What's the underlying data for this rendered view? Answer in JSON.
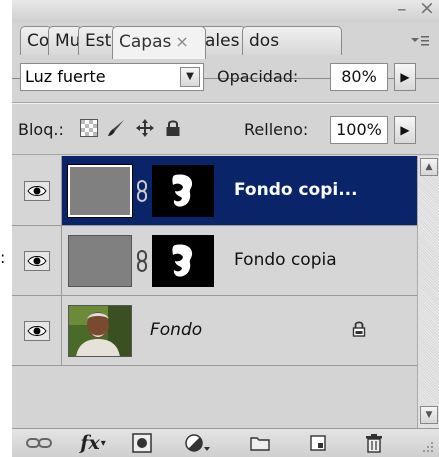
{
  "tabs": [
    {
      "label": "Co",
      "active": false
    },
    {
      "label": "Mu",
      "active": false
    },
    {
      "label": "Est",
      "active": false
    },
    {
      "label": "Capas",
      "active": true,
      "close": "×"
    },
    {
      "label": "ales",
      "active": false
    },
    {
      "label": "dos",
      "active": false
    }
  ],
  "window_controls": {
    "close": "×",
    "minimize": "–",
    "menu": "▾≡"
  },
  "blend": {
    "mode": "Luz fuerte",
    "opacity_label": "Opacidad:",
    "opacity_value": "80%"
  },
  "lock": {
    "label": "Bloq.:",
    "fill_label": "Relleno:",
    "fill_value": "100%",
    "icons": [
      "lock-transparent-icon",
      "lock-brush-icon",
      "lock-move-icon",
      "lock-all-icon"
    ]
  },
  "layers": [
    {
      "name": "Fondo copi...",
      "selected": true,
      "has_mask": true,
      "italic": false
    },
    {
      "name": "Fondo copia",
      "selected": false,
      "has_mask": true,
      "italic": false
    },
    {
      "name": "Fondo",
      "selected": false,
      "has_mask": false,
      "italic": true,
      "locked": true
    }
  ],
  "side_text": ":",
  "bottom_tools": [
    "link-icon",
    "fx-icon",
    "mask-icon",
    "adjustment-icon",
    "folder-icon",
    "new-layer-icon",
    "trash-icon"
  ],
  "fx_label": "fx"
}
